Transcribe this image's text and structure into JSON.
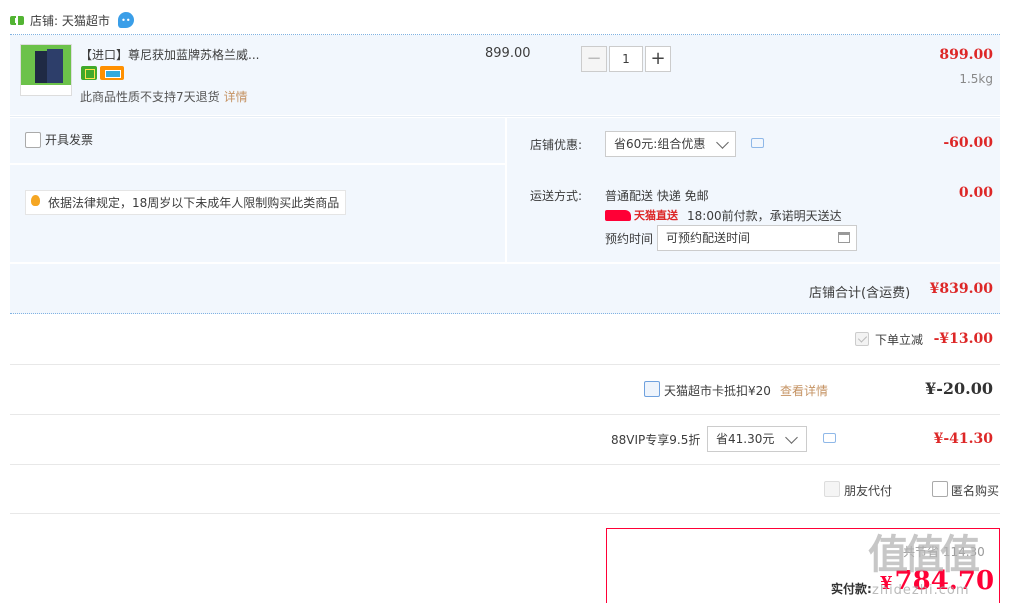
{
  "shop": {
    "label": "店铺: 天猫超市"
  },
  "item": {
    "title": "【进口】尊尼获加蓝牌苏格兰威...",
    "no_return": "此商品性质不支持7天退货",
    "detail_link": "详情",
    "unit_price": "899.00",
    "quantity": "1",
    "minus": "−",
    "plus": "+",
    "subtotal": "899.00",
    "weight": "1.5kg"
  },
  "invoice": {
    "label": "开具发票"
  },
  "law_notice": "依据法律规定，18周岁以下未成年人限制购买此类商品",
  "discount": {
    "label": "店铺优惠:",
    "selected": "省60元:组合优惠",
    "amount": "-60.00"
  },
  "shipping": {
    "label": "运送方式:",
    "method": "普通配送 快递 免邮",
    "fee": "0.00",
    "direct_label": "天猫直送",
    "promise": "18:00前付款，承诺明天送达",
    "appointment_label": "预约时间",
    "appointment_value": "可预约配送时间"
  },
  "shop_total": {
    "label": "店铺合计(含运费)",
    "amount": "¥839.00"
  },
  "instant_discount": {
    "label": "下单立减",
    "amount": "-¥13.00"
  },
  "supermarket_card": {
    "label": "天猫超市卡抵扣¥20",
    "link": "查看详情",
    "amount": "¥-20.00"
  },
  "vip": {
    "label": "88VIP专享9.5折",
    "selected": "省41.30元",
    "amount": "¥-41.30"
  },
  "options": {
    "friend_pay": "朋友代付",
    "anonymous": "匿名购买"
  },
  "payment": {
    "label": "实付款:",
    "yen": "¥",
    "amount": "784.70",
    "save_tip": "共节省 114.30"
  },
  "watermark": {
    "logo": "值值值",
    "url": "zhidezhi.com"
  },
  "colors": {
    "price_red": "#dd2727",
    "tmall_red": "#ff0036",
    "panel_bg": "#f2f7fd",
    "link_tan": "#c59363"
  }
}
